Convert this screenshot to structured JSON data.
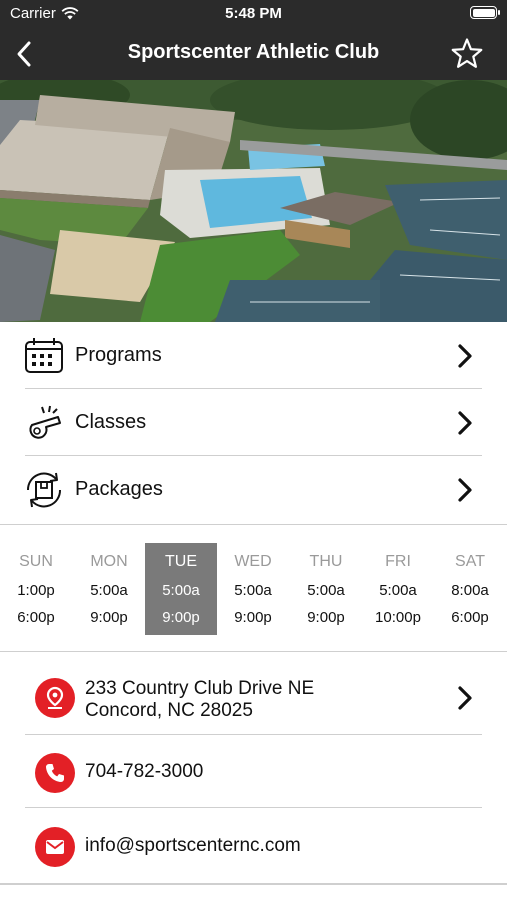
{
  "status_bar": {
    "carrier": "Carrier",
    "time": "5:48 PM"
  },
  "nav": {
    "title": "Sportscenter Athletic Club",
    "back_icon": "chevron-left-icon",
    "favorite_icon": "star-outline-icon"
  },
  "menu": [
    {
      "label": "Programs",
      "icon": "calendar-icon"
    },
    {
      "label": "Classes",
      "icon": "whistle-icon"
    },
    {
      "label": "Packages",
      "icon": "package-icon"
    }
  ],
  "hours": [
    {
      "day": "SUN",
      "open": "1:00p",
      "close": "6:00p",
      "selected": false
    },
    {
      "day": "MON",
      "open": "5:00a",
      "close": "9:00p",
      "selected": false
    },
    {
      "day": "TUE",
      "open": "5:00a",
      "close": "9:00p",
      "selected": true
    },
    {
      "day": "WED",
      "open": "5:00a",
      "close": "9:00p",
      "selected": false
    },
    {
      "day": "THU",
      "open": "5:00a",
      "close": "9:00p",
      "selected": false
    },
    {
      "day": "FRI",
      "open": "5:00a",
      "close": "10:00p",
      "selected": false
    },
    {
      "day": "SAT",
      "open": "8:00a",
      "close": "6:00p",
      "selected": false
    }
  ],
  "contact": {
    "address_line1": "233 Country Club Drive NE",
    "address_line2": "Concord, NC 28025",
    "phone": "704-782-3000",
    "email": "info@sportscenternc.com"
  },
  "colors": {
    "bar": "#2b2b2b",
    "accent_red": "#e32026",
    "selected_day": "#7a7a7a"
  }
}
